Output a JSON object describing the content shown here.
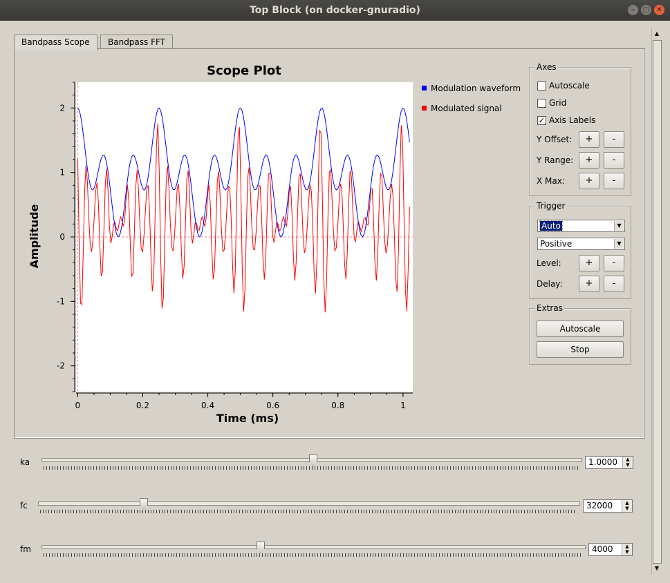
{
  "window": {
    "title": "Top Block (on docker-gnuradio)"
  },
  "tabs": [
    {
      "label": "Bandpass Scope",
      "active": true
    },
    {
      "label": "Bandpass FFT",
      "active": false
    }
  ],
  "plot": {
    "title": "Scope Plot",
    "xlabel": "Time (ms)",
    "ylabel": "Amplitude",
    "legend": [
      {
        "label": "Modulation waveform",
        "color": "#0000ff"
      },
      {
        "label": "Modulated signal",
        "color": "#ff0000"
      }
    ]
  },
  "chart_data": {
    "type": "line",
    "title": "Scope Plot",
    "xlabel": "Time (ms)",
    "ylabel": "Amplitude",
    "xlim": [
      -0.005,
      1.03
    ],
    "ylim": [
      -2.4,
      2.4
    ],
    "xticks": [
      "0",
      "0.2",
      "0.4",
      "0.6",
      "0.8",
      "1"
    ],
    "yticks": [
      "2",
      "1",
      "0",
      "-1",
      "-2"
    ],
    "trigger_marker": {
      "x": 0.0,
      "y": 0.0
    },
    "series": [
      {
        "name": "Modulation waveform",
        "color": "#0000ff",
        "model": {
          "period_ms": 0.25,
          "fundamental_khz": 4,
          "harmonic_khz": 12,
          "offset": 1.0,
          "peak": 2.0,
          "trough": 0.2
        }
      },
      {
        "name": "Modulated signal",
        "color": "#ff0000",
        "model": {
          "carrier_khz": 32,
          "peak": 1.5,
          "trough": -1.75
        }
      }
    ]
  },
  "axes_panel": {
    "title": "Axes",
    "autoscale": {
      "label": "Autoscale",
      "checked": false
    },
    "grid": {
      "label": "Grid",
      "checked": false
    },
    "axis_labels": {
      "label": "Axis Labels",
      "checked": true
    },
    "rows": [
      {
        "label": "Y Offset:",
        "plus": "+",
        "minus": "-"
      },
      {
        "label": "Y Range:",
        "plus": "+",
        "minus": "-"
      },
      {
        "label": "X Max:",
        "plus": "+",
        "minus": "-"
      }
    ]
  },
  "trigger_panel": {
    "title": "Trigger",
    "mode": "Auto",
    "slope": "Positive",
    "rows": [
      {
        "label": "Level:",
        "plus": "+",
        "minus": "-"
      },
      {
        "label": "Delay:",
        "plus": "+",
        "minus": "-"
      }
    ]
  },
  "extras_panel": {
    "title": "Extras",
    "autoscale_button": "Autoscale",
    "stop_button": "Stop"
  },
  "sliders": [
    {
      "label": "ka",
      "value": "1.0000",
      "fraction": 0.503
    },
    {
      "label": "fc",
      "value": "32000",
      "fraction": 0.194
    },
    {
      "label": "fm",
      "value": "4000",
      "fraction": 0.402
    }
  ]
}
